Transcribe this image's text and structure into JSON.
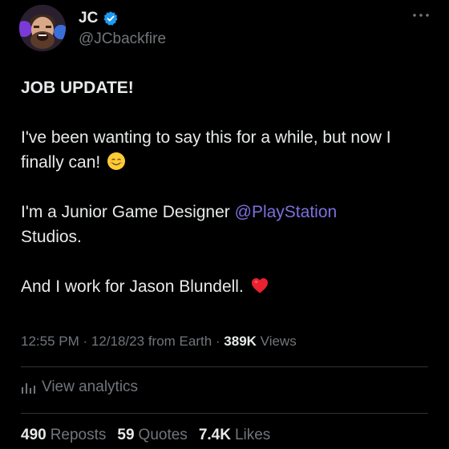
{
  "author": {
    "display_name": "JC",
    "handle": "@JCbackfire"
  },
  "tweet": {
    "headline": "JOB UPDATE!",
    "line1": "I've been wanting to say this for a while, but now I finally can!",
    "line2_prefix": "I'm a Junior Game Designer ",
    "line2_mention": "@PlayStation",
    "line2_suffix": "Studios.",
    "line3": "And I work for Jason Blundell."
  },
  "meta": {
    "time": "12:55 PM",
    "date": "12/18/23",
    "source": "from Earth",
    "views_count": "389K",
    "views_label": "Views"
  },
  "analytics": {
    "label": "View analytics"
  },
  "stats": {
    "reposts_count": "490",
    "reposts_label": "Reposts",
    "quotes_count": "59",
    "quotes_label": "Quotes",
    "likes_count": "7.4K",
    "likes_label": "Likes"
  },
  "colors": {
    "background": "#000000",
    "text": "#e7e9ea",
    "secondary": "#71767b",
    "mention": "#7a70dd",
    "verified": "#1d9bf0"
  }
}
